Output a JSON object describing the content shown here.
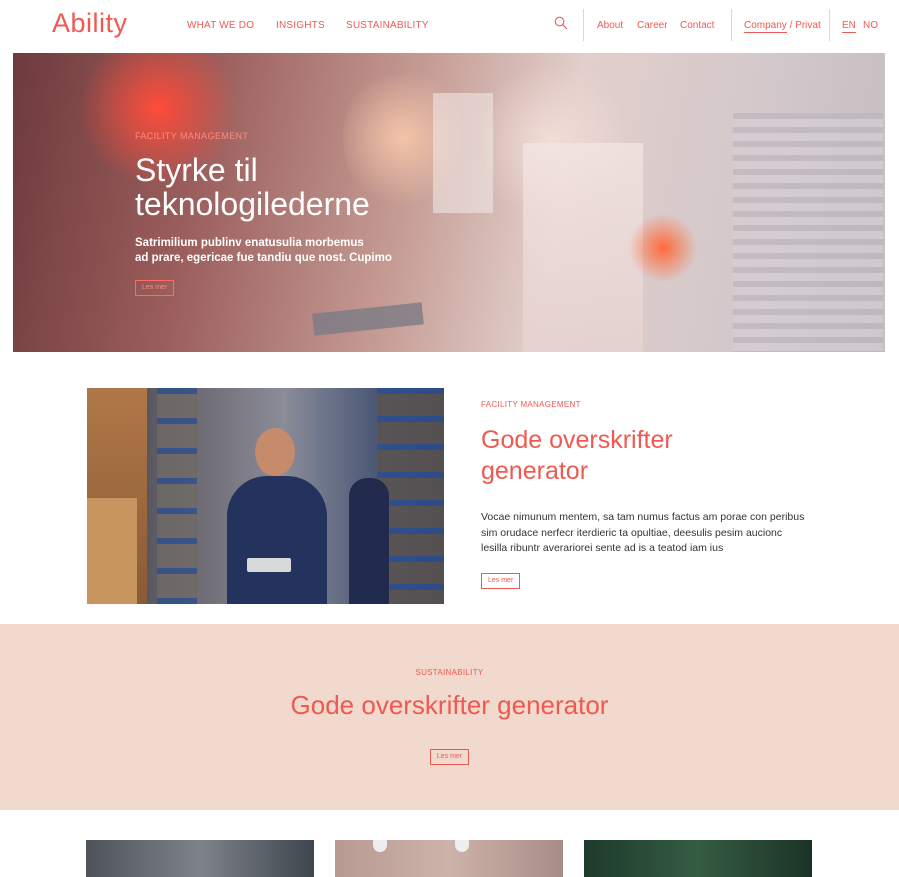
{
  "brand": {
    "logo_text": "Ability"
  },
  "nav": {
    "items": [
      {
        "label": "WHAT WE DO"
      },
      {
        "label": "INSIGHTS"
      },
      {
        "label": "SUSTAINABILITY"
      }
    ],
    "search_icon": "search-icon",
    "utility": [
      {
        "label": "About"
      },
      {
        "label": "Career"
      },
      {
        "label": "Contact"
      }
    ],
    "audience": {
      "company": "Company",
      "separator": " / ",
      "private": "Privat"
    },
    "languages": [
      {
        "label": "EN",
        "active": true
      },
      {
        "label": "NO",
        "active": false
      }
    ]
  },
  "hero": {
    "eyebrow": "FACILITY MANAGEMENT",
    "title_line1": "Styrke til",
    "title_line2": "teknologilederne",
    "sub_line1": "Satrimilium publinv enatusulia morbemus",
    "sub_line2": "ad prare, egericae fue tandiu que nost. Cupimo",
    "button": "Les mer"
  },
  "feature": {
    "eyebrow": "FACILITY MANAGEMENT",
    "title_line1": "Gode overskrifter",
    "title_line2": "generator",
    "body_line1": "Vocae nimunum mentem, sa tam numus factus am porae con peribus",
    "body_line2": "sim orudace nerfecr iterdieric ta opultiae, deesulis pesim aucionc",
    "body_line3": "lesilla ribuntr averariorei sente ad is a teatod iam ius",
    "button": "Les mer"
  },
  "sustainability": {
    "eyebrow": "SUSTAINABILITY",
    "title": "Gode overskrifter generator",
    "button": "Les mer"
  },
  "colors": {
    "accent": "#ee5a52",
    "band_bg": "#f1d9cd",
    "text": "#333333"
  }
}
